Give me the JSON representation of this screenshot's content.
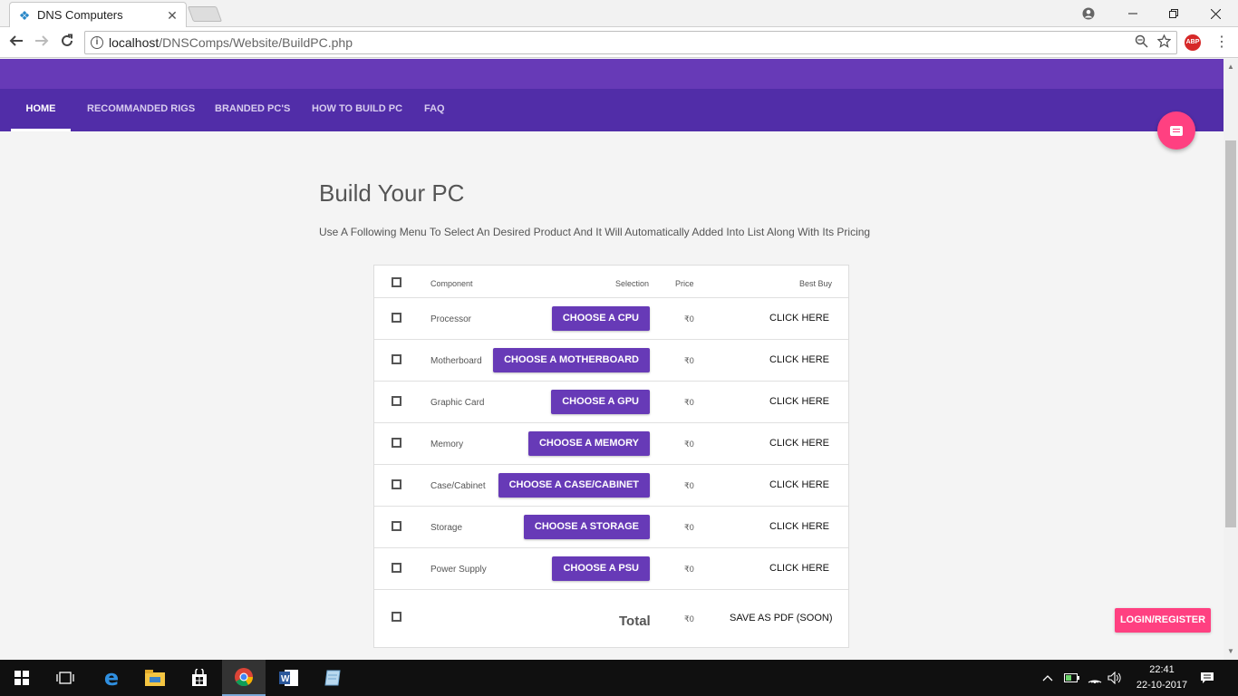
{
  "browser": {
    "tab_title": "DNS Computers",
    "tab_close": "✕",
    "url_host": "localhost",
    "url_path": "/DNSComps/Website/BuildPC.php",
    "abp_label": "ABP"
  },
  "nav": {
    "items": [
      {
        "label": "HOME"
      },
      {
        "label": "RECOMMANDED RIGS"
      },
      {
        "label": "BRANDED PC'S"
      },
      {
        "label": "HOW TO BUILD PC"
      },
      {
        "label": "FAQ"
      }
    ]
  },
  "main": {
    "title": "Build Your PC",
    "description": "Use A Following Menu To Select An Desired Product And It Will Automatically Added Into List Along With Its Pricing"
  },
  "table": {
    "headers": {
      "component": "Component",
      "selection": "Selection",
      "price": "Price",
      "best_buy": "Best Buy"
    },
    "rows": [
      {
        "component": "Processor",
        "button": "CHOOSE A CPU",
        "price": "₹0",
        "best_buy": "CLICK HERE"
      },
      {
        "component": "Motherboard",
        "button": "CHOOSE A MOTHERBOARD",
        "price": "₹0",
        "best_buy": "CLICK HERE"
      },
      {
        "component": "Graphic Card",
        "button": "CHOOSE A GPU",
        "price": "₹0",
        "best_buy": "CLICK HERE"
      },
      {
        "component": "Memory",
        "button": "CHOOSE A MEMORY",
        "price": "₹0",
        "best_buy": "CLICK HERE"
      },
      {
        "component": "Case/Cabinet",
        "button": "CHOOSE A CASE/CABINET",
        "price": "₹0",
        "best_buy": "CLICK HERE"
      },
      {
        "component": "Storage",
        "button": "CHOOSE A STORAGE",
        "price": "₹0",
        "best_buy": "CLICK HERE"
      },
      {
        "component": "Power Supply",
        "button": "CHOOSE A PSU",
        "price": "₹0",
        "best_buy": "CLICK HERE"
      }
    ],
    "total": {
      "label": "Total",
      "price": "₹0",
      "action": "SAVE AS PDF (SOON)"
    }
  },
  "login_button": "LOGIN/REGISTER",
  "taskbar": {
    "time": "22:41",
    "date": "22-10-2017"
  },
  "colors": {
    "primary": "#673ab7",
    "primary_dark": "#512da8",
    "accent": "#ff4081"
  }
}
